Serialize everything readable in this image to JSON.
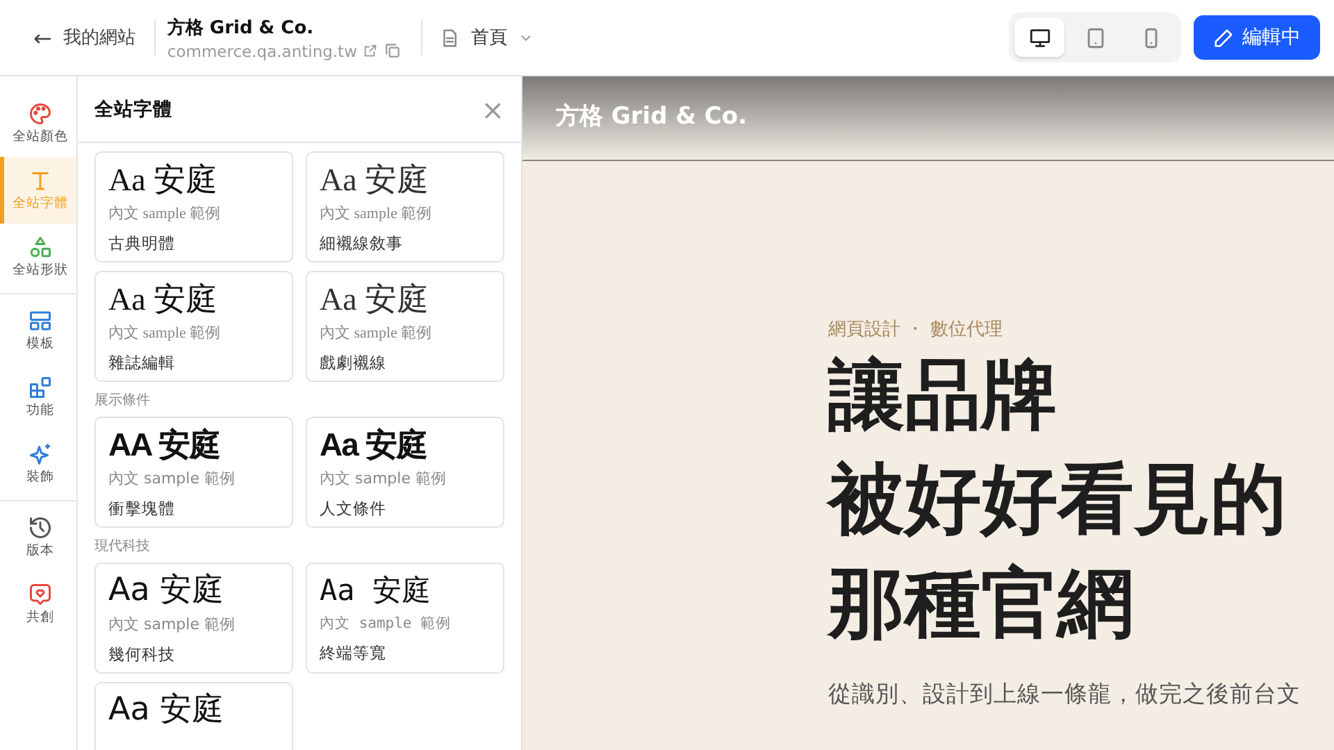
{
  "topbar": {
    "back": {
      "icon": "←",
      "label": "我的網站"
    },
    "site": {
      "name": "方格 Grid & Co.",
      "url": "commerce.qa.anting.tw"
    },
    "page_menu": {
      "label": "首頁"
    },
    "devices": [
      {
        "kind": "desktop",
        "selected": true
      },
      {
        "kind": "tablet",
        "selected": false
      },
      {
        "kind": "phone",
        "selected": false
      }
    ],
    "edit_button": {
      "label": "編輯中"
    }
  },
  "rail": {
    "groups": [
      {
        "items": [
          {
            "kind": "palette",
            "label": "全站顏色",
            "color": "#e5483a",
            "selected": false
          },
          {
            "kind": "type",
            "label": "全站字體",
            "color": "#f0a020",
            "selected": true
          },
          {
            "kind": "shapes",
            "label": "全站形狀",
            "color": "#4caf50",
            "selected": false
          }
        ]
      },
      {
        "items": [
          {
            "kind": "template",
            "label": "模板",
            "color": "#2f7fd8",
            "selected": false
          },
          {
            "kind": "blocks",
            "label": "功能",
            "color": "#2f7fd8",
            "selected": false
          },
          {
            "kind": "sparkle",
            "label": "裝飾",
            "color": "#2f7fd8",
            "selected": false
          }
        ]
      },
      {
        "items": [
          {
            "kind": "history",
            "label": "版本",
            "color": "#555555",
            "selected": false
          },
          {
            "kind": "heart",
            "label": "共創",
            "color": "#e5483a",
            "selected": false
          }
        ]
      }
    ]
  },
  "panel": {
    "title": "全站字體",
    "close": "×",
    "groups": [
      {
        "cards": [
          {
            "kind": "serif",
            "sample": "Aa 安庭",
            "body_sample": "內文 sample 範例",
            "name": "古典明體"
          },
          {
            "kind": "serif-light",
            "sample": "Aa 安庭",
            "body_sample": "內文 sample 範例",
            "name": "細襯線敘事"
          },
          {
            "kind": "serif",
            "sample": "Aa 安庭",
            "body_sample": "內文 sample 範例",
            "name": "雜誌編輯"
          },
          {
            "kind": "serif-light",
            "sample": "Aa 安庭",
            "body_sample": "內文 sample 範例",
            "name": "戲劇襯線"
          }
        ]
      },
      {
        "heading": "展示條件",
        "cards": [
          {
            "kind": "condensed",
            "sample": "AA 安庭",
            "body_sample": "內文 sample 範例",
            "name": "衝擊塊體"
          },
          {
            "kind": "condensed",
            "sample": "Aa 安庭",
            "body_sample": "內文 sample 範例",
            "name": "人文條件"
          }
        ]
      },
      {
        "heading": "現代科技",
        "cards": [
          {
            "kind": "sans",
            "sample": "Aa 安庭",
            "body_sample": "內文 sample 範例",
            "name": "幾何科技"
          },
          {
            "kind": "mono",
            "sample": "Aa 安庭",
            "body_sample": "內文 sample 範例",
            "name": "終端等寬"
          },
          {
            "kind": "sans",
            "sample": "Aa 安庭"
          }
        ]
      }
    ]
  },
  "preview": {
    "brand": "方格 Grid & Co.",
    "eyebrow": "網頁設計 ・ 數位代理",
    "headline_lines": [
      "讓品牌",
      "被好好看見的",
      "那種官網"
    ],
    "body": "從識別、設計到上線一條龍，做完之後前台文"
  }
}
